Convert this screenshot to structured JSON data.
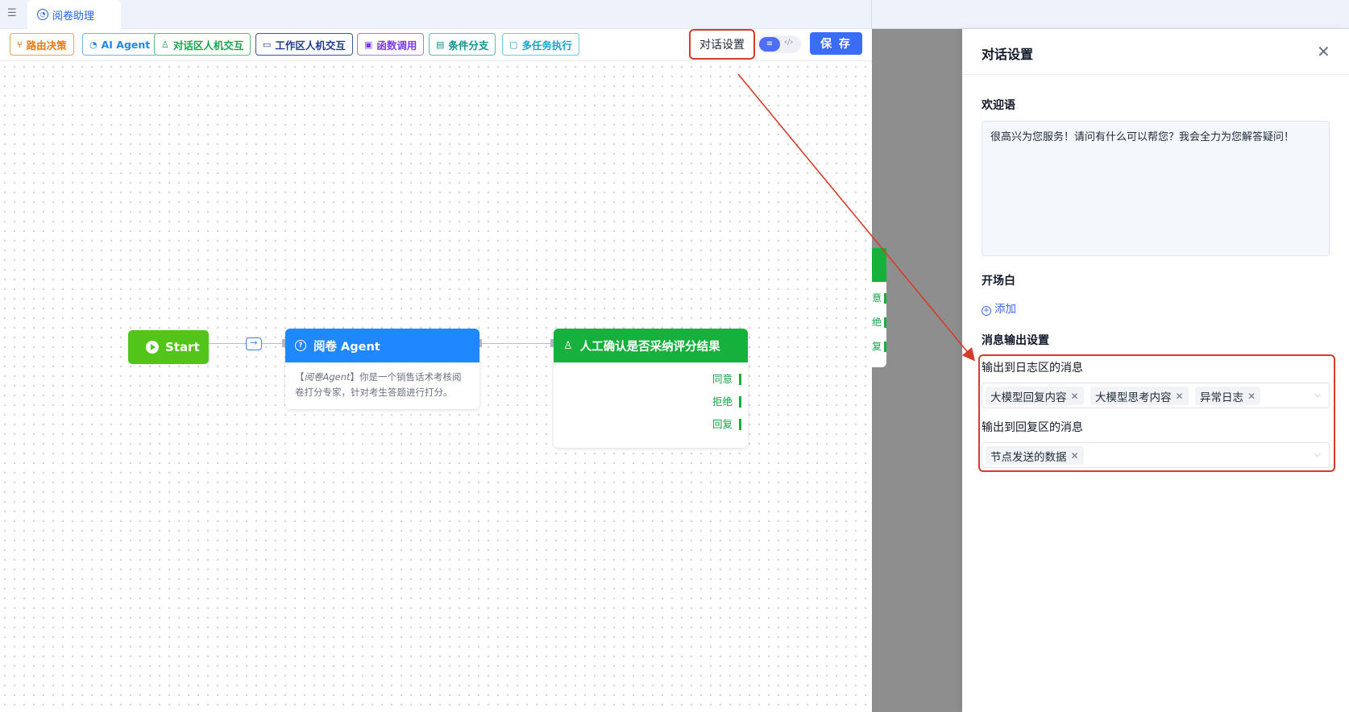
{
  "tab": {
    "title": "阅卷助理"
  },
  "toolbar": {
    "route": "路由决策",
    "agent": "AI Agent",
    "chat": "对话区人机交互",
    "work": "工作区人机交互",
    "func": "函数调用",
    "cond": "条件分支",
    "multi": "多任务执行",
    "dialog_settings": "对话设置",
    "save": "保 存"
  },
  "nodes": {
    "start": {
      "label": "Start"
    },
    "agent": {
      "title": "阅卷 Agent",
      "desc_prefix": "【",
      "desc_name": "阅卷Agent",
      "desc_rest": "】你是一个销售话术考核阅卷打分专家，针对考生答题进行打分。"
    },
    "human": {
      "title": "人工确认是否采纳评分结果",
      "options": [
        "同意",
        "拒绝",
        "回复"
      ]
    },
    "peek_options": [
      "意",
      "绝",
      "复"
    ]
  },
  "drawer": {
    "title": "对话设置",
    "welcome_label": "欢迎语",
    "welcome_text": "很高兴为您服务！请问有什么可以帮您？我会全力为您解答疑问！",
    "opening_label": "开场白",
    "add_label": "添加",
    "output_label": "消息输出设置",
    "log_label": "输出到日志区的消息",
    "log_chips": [
      "大模型回复内容",
      "大模型思考内容",
      "异常日志"
    ],
    "reply_label": "输出到回复区的消息",
    "reply_chips": [
      "节点发送的数据"
    ]
  },
  "colors": {
    "accent": "#3b6cf6",
    "annotation": "#d63c2a",
    "start": "#52c41a",
    "agent": "#1f88ff",
    "human": "#16b03c"
  }
}
